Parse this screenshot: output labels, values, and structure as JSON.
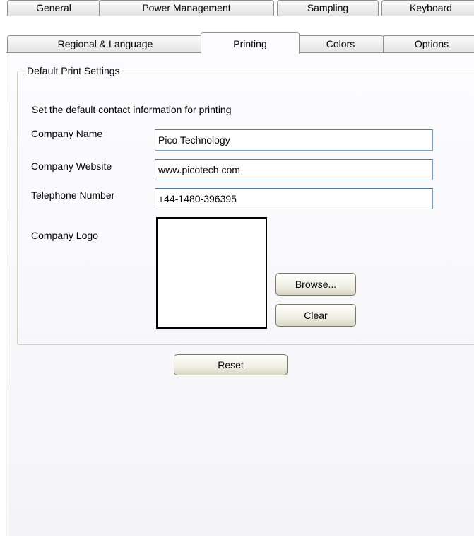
{
  "tabs": {
    "row1": [
      "General",
      "Power Management",
      "Sampling",
      "Keyboard"
    ],
    "row2": [
      "Regional & Language",
      "Printing",
      "Colors",
      "Options"
    ],
    "active": "Printing"
  },
  "group": {
    "title": "Default Print Settings",
    "description": "Set the default contact information for printing"
  },
  "fields": {
    "company_name": {
      "label": "Company Name",
      "value": "Pico Technology"
    },
    "company_website": {
      "label": "Company Website",
      "value": "www.picotech.com"
    },
    "telephone": {
      "label": "Telephone Number",
      "value": "+44-1480-396395"
    }
  },
  "logo": {
    "label": "Company Logo"
  },
  "buttons": {
    "browse": "Browse...",
    "clear": "Clear",
    "reset": "Reset"
  },
  "colors": {
    "tab_border": "#8e8f8f",
    "textbox_border": "#7f9db9",
    "group_border": "#d0d0bf"
  }
}
